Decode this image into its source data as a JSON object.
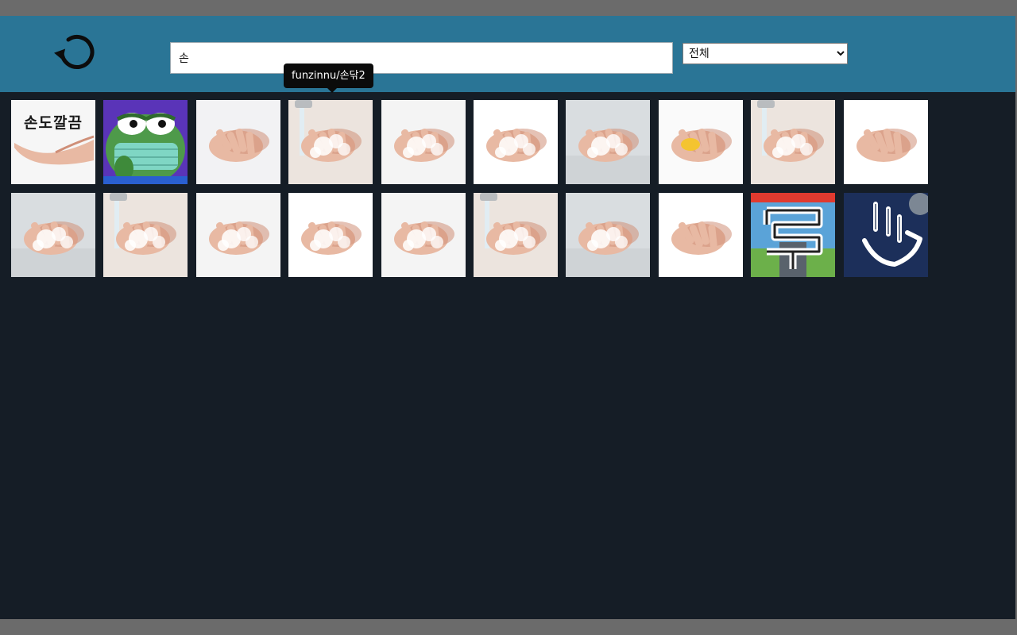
{
  "search": {
    "value": "손"
  },
  "category": {
    "selected": "전체"
  },
  "tooltip": {
    "text": "funzinnu/손닦2"
  },
  "tiles": [
    {
      "kind": "text-hand",
      "label": "손도깔끔"
    },
    {
      "kind": "frog-mask"
    },
    {
      "kind": "hands-water"
    },
    {
      "kind": "hands-faucet"
    },
    {
      "kind": "hands-soap"
    },
    {
      "kind": "hands-soap-white"
    },
    {
      "kind": "hands-sink"
    },
    {
      "kind": "hands-soap-bar"
    },
    {
      "kind": "hands-faucet"
    },
    {
      "kind": "hands-rub-white"
    },
    {
      "kind": "hands-sink"
    },
    {
      "kind": "hands-faucet"
    },
    {
      "kind": "hands-soap"
    },
    {
      "kind": "hands-soap-white"
    },
    {
      "kind": "hands-soap"
    },
    {
      "kind": "hands-faucet"
    },
    {
      "kind": "hands-sink"
    },
    {
      "kind": "hands-rub-white"
    },
    {
      "kind": "game-scene"
    },
    {
      "kind": "neon-hand"
    }
  ],
  "colors": {
    "header": "#2a7596",
    "background": "#151d26",
    "tooltip": "#0b0b0b"
  }
}
